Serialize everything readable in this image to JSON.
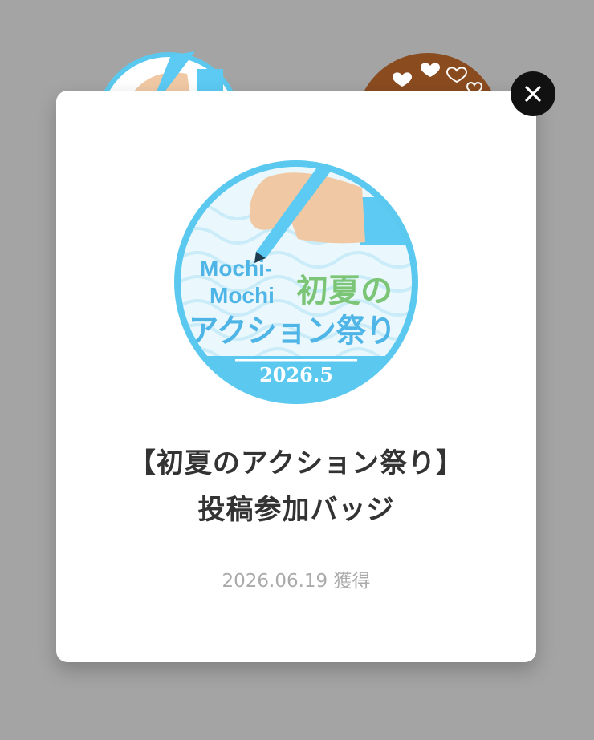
{
  "colors": {
    "overlay": "#a4a4a4",
    "badge_ring": "#5bc9ef",
    "badge_text_blue": "#4fb5e6",
    "badge_text_green": "#7cc576",
    "hand": "#f0c9a4",
    "sleeve": "#5ccaf3",
    "brown_badge": "#8a4b1f",
    "title_text": "#333333",
    "date_text": "#aaaaaa"
  },
  "badge": {
    "brand_line1": "Mochi-",
    "brand_line2": "Mochi",
    "title_line1": "初夏の",
    "title_line2": "アクション祭り",
    "year": "2026.5"
  },
  "modal": {
    "title_line1": "【初夏のアクション祭り】",
    "title_line2": "投稿参加バッジ",
    "earned_date": "2026.06.19 獲得"
  },
  "icons": {
    "close": "close-icon",
    "hand_pen": "hand-pen-icon",
    "hearts": "heart-icon"
  }
}
